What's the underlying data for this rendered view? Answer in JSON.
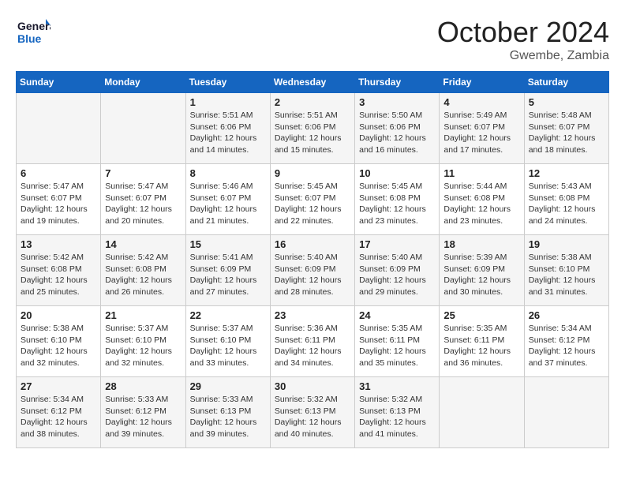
{
  "header": {
    "logo_line1": "General",
    "logo_line2": "Blue",
    "month": "October 2024",
    "location": "Gwembe, Zambia"
  },
  "weekdays": [
    "Sunday",
    "Monday",
    "Tuesday",
    "Wednesday",
    "Thursday",
    "Friday",
    "Saturday"
  ],
  "weeks": [
    [
      {
        "day": "",
        "info": ""
      },
      {
        "day": "",
        "info": ""
      },
      {
        "day": "1",
        "info": "Sunrise: 5:51 AM\nSunset: 6:06 PM\nDaylight: 12 hours and 14 minutes."
      },
      {
        "day": "2",
        "info": "Sunrise: 5:51 AM\nSunset: 6:06 PM\nDaylight: 12 hours and 15 minutes."
      },
      {
        "day": "3",
        "info": "Sunrise: 5:50 AM\nSunset: 6:06 PM\nDaylight: 12 hours and 16 minutes."
      },
      {
        "day": "4",
        "info": "Sunrise: 5:49 AM\nSunset: 6:07 PM\nDaylight: 12 hours and 17 minutes."
      },
      {
        "day": "5",
        "info": "Sunrise: 5:48 AM\nSunset: 6:07 PM\nDaylight: 12 hours and 18 minutes."
      }
    ],
    [
      {
        "day": "6",
        "info": "Sunrise: 5:47 AM\nSunset: 6:07 PM\nDaylight: 12 hours and 19 minutes."
      },
      {
        "day": "7",
        "info": "Sunrise: 5:47 AM\nSunset: 6:07 PM\nDaylight: 12 hours and 20 minutes."
      },
      {
        "day": "8",
        "info": "Sunrise: 5:46 AM\nSunset: 6:07 PM\nDaylight: 12 hours and 21 minutes."
      },
      {
        "day": "9",
        "info": "Sunrise: 5:45 AM\nSunset: 6:07 PM\nDaylight: 12 hours and 22 minutes."
      },
      {
        "day": "10",
        "info": "Sunrise: 5:45 AM\nSunset: 6:08 PM\nDaylight: 12 hours and 23 minutes."
      },
      {
        "day": "11",
        "info": "Sunrise: 5:44 AM\nSunset: 6:08 PM\nDaylight: 12 hours and 23 minutes."
      },
      {
        "day": "12",
        "info": "Sunrise: 5:43 AM\nSunset: 6:08 PM\nDaylight: 12 hours and 24 minutes."
      }
    ],
    [
      {
        "day": "13",
        "info": "Sunrise: 5:42 AM\nSunset: 6:08 PM\nDaylight: 12 hours and 25 minutes."
      },
      {
        "day": "14",
        "info": "Sunrise: 5:42 AM\nSunset: 6:08 PM\nDaylight: 12 hours and 26 minutes."
      },
      {
        "day": "15",
        "info": "Sunrise: 5:41 AM\nSunset: 6:09 PM\nDaylight: 12 hours and 27 minutes."
      },
      {
        "day": "16",
        "info": "Sunrise: 5:40 AM\nSunset: 6:09 PM\nDaylight: 12 hours and 28 minutes."
      },
      {
        "day": "17",
        "info": "Sunrise: 5:40 AM\nSunset: 6:09 PM\nDaylight: 12 hours and 29 minutes."
      },
      {
        "day": "18",
        "info": "Sunrise: 5:39 AM\nSunset: 6:09 PM\nDaylight: 12 hours and 30 minutes."
      },
      {
        "day": "19",
        "info": "Sunrise: 5:38 AM\nSunset: 6:10 PM\nDaylight: 12 hours and 31 minutes."
      }
    ],
    [
      {
        "day": "20",
        "info": "Sunrise: 5:38 AM\nSunset: 6:10 PM\nDaylight: 12 hours and 32 minutes."
      },
      {
        "day": "21",
        "info": "Sunrise: 5:37 AM\nSunset: 6:10 PM\nDaylight: 12 hours and 32 minutes."
      },
      {
        "day": "22",
        "info": "Sunrise: 5:37 AM\nSunset: 6:10 PM\nDaylight: 12 hours and 33 minutes."
      },
      {
        "day": "23",
        "info": "Sunrise: 5:36 AM\nSunset: 6:11 PM\nDaylight: 12 hours and 34 minutes."
      },
      {
        "day": "24",
        "info": "Sunrise: 5:35 AM\nSunset: 6:11 PM\nDaylight: 12 hours and 35 minutes."
      },
      {
        "day": "25",
        "info": "Sunrise: 5:35 AM\nSunset: 6:11 PM\nDaylight: 12 hours and 36 minutes."
      },
      {
        "day": "26",
        "info": "Sunrise: 5:34 AM\nSunset: 6:12 PM\nDaylight: 12 hours and 37 minutes."
      }
    ],
    [
      {
        "day": "27",
        "info": "Sunrise: 5:34 AM\nSunset: 6:12 PM\nDaylight: 12 hours and 38 minutes."
      },
      {
        "day": "28",
        "info": "Sunrise: 5:33 AM\nSunset: 6:12 PM\nDaylight: 12 hours and 39 minutes."
      },
      {
        "day": "29",
        "info": "Sunrise: 5:33 AM\nSunset: 6:13 PM\nDaylight: 12 hours and 39 minutes."
      },
      {
        "day": "30",
        "info": "Sunrise: 5:32 AM\nSunset: 6:13 PM\nDaylight: 12 hours and 40 minutes."
      },
      {
        "day": "31",
        "info": "Sunrise: 5:32 AM\nSunset: 6:13 PM\nDaylight: 12 hours and 41 minutes."
      },
      {
        "day": "",
        "info": ""
      },
      {
        "day": "",
        "info": ""
      }
    ]
  ]
}
